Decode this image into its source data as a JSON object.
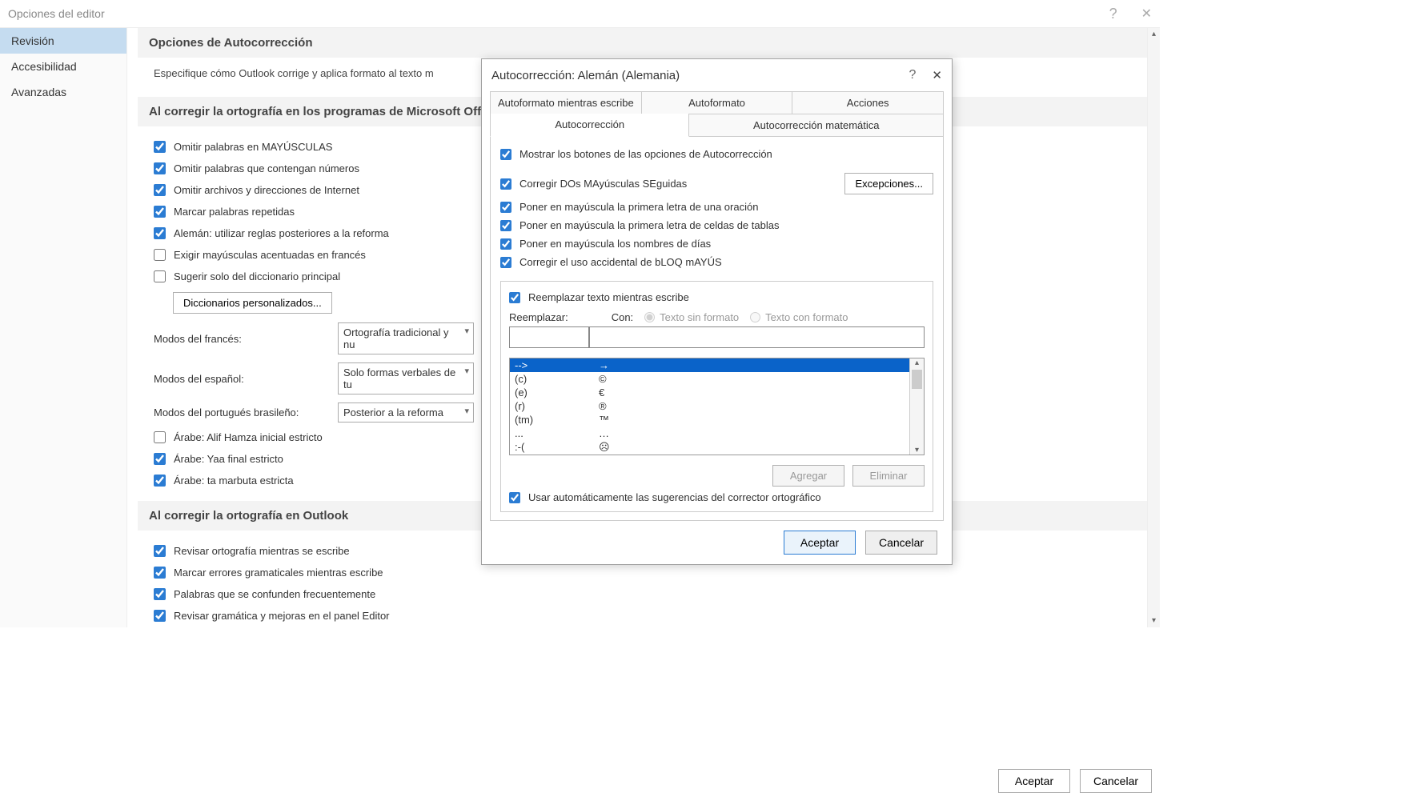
{
  "parent": {
    "title": "Opciones del editor",
    "sidebar": [
      "Revisión",
      "Accesibilidad",
      "Avanzadas"
    ],
    "section1_title": "Opciones de Autocorrección",
    "section1_desc": "Especifique cómo Outlook corrige y aplica formato al texto m",
    "section2_title": "Al corregir la ortografía en los programas de Microsoft Off",
    "checks": {
      "c1": "Omitir palabras en MAYÚSCULAS",
      "c2": "Omitir palabras que contengan números",
      "c3": "Omitir archivos y direcciones de Internet",
      "c4": "Marcar palabras repetidas",
      "c5": "Alemán: utilizar reglas posteriores a la reforma",
      "c6": "Exigir mayúsculas acentuadas en francés",
      "c7": "Sugerir solo del diccionario principal"
    },
    "dict_btn": "Diccionarios personalizados...",
    "combo1_label": "Modos del francés:",
    "combo1_val": "Ortografía tradicional y nu",
    "combo2_label": "Modos del español:",
    "combo2_val": "Solo formas verbales de tu",
    "combo3_label": "Modos del portugués brasileño:",
    "combo3_val": "Posterior a la reforma",
    "c8": "Árabe: Alif Hamza inicial estricto",
    "c9": "Árabe: Yaa final estricto",
    "c10": "Árabe: ta marbuta estricta",
    "section3_title": "Al corregir la ortografía en Outlook",
    "c11": "Revisar ortografía mientras se escribe",
    "c12": "Marcar errores gramaticales mientras escribe",
    "c13": "Palabras que se confunden frecuentemente",
    "c14": "Revisar gramática y mejoras en el panel Editor",
    "accept": "Aceptar",
    "cancel": "Cancelar"
  },
  "modal": {
    "title": "Autocorrección: Alemán (Alemania)",
    "tabs_top": [
      "Autoformato mientras escribe",
      "Autoformato",
      "Acciones"
    ],
    "tabs_bot": [
      "Autocorrección",
      "Autocorrección matemática"
    ],
    "opt_show": "Mostrar los botones de las opciones de Autocorrección",
    "opt_caps": "Corregir DOs MAyúsculas SEguidas",
    "opt_sent": "Poner en mayúscula la primera letra de una oración",
    "opt_table": "Poner en mayúscula la primera letra de celdas de tablas",
    "opt_days": "Poner en mayúscula los nombres de días",
    "opt_capslock": "Corregir el uso accidental de bLOQ mAYÚS",
    "exceptions": "Excepciones...",
    "opt_replace": "Reemplazar texto mientras escribe",
    "replace_label": "Reemplazar:",
    "with_label": "Con:",
    "radio_plain": "Texto sin formato",
    "radio_fmt": "Texto con formato",
    "list": [
      {
        "r": "-->",
        "w": "→"
      },
      {
        "r": "(c)",
        "w": "©"
      },
      {
        "r": "(e)",
        "w": "€"
      },
      {
        "r": "(r)",
        "w": "®"
      },
      {
        "r": "(tm)",
        "w": "™"
      },
      {
        "r": "...",
        "w": "…"
      },
      {
        "r": ":-(",
        "w": "☹"
      }
    ],
    "add": "Agregar",
    "delete": "Eliminar",
    "opt_spell": "Usar automáticamente las sugerencias del corrector ortográfico",
    "accept": "Aceptar",
    "cancel": "Cancelar"
  }
}
